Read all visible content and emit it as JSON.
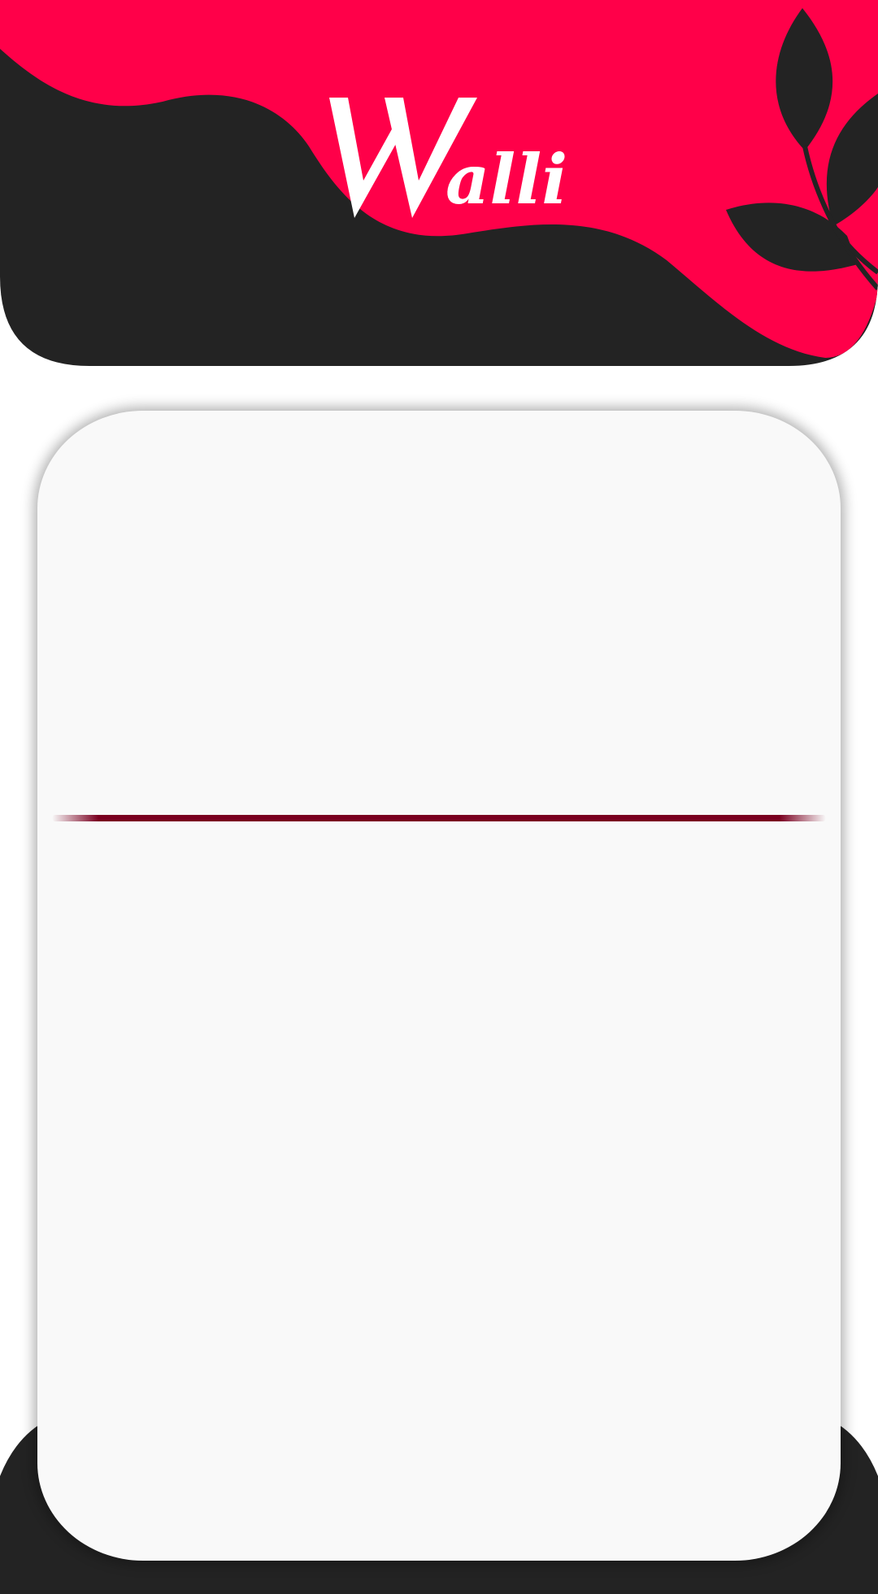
{
  "app": {
    "logo_text": "Walli"
  },
  "colors": {
    "brand_red": "#ff0049",
    "dark": "#232323",
    "card_bg": "#f9f9f9",
    "divider": "#7a0020",
    "logo_text": "#ffffff"
  },
  "icons": {
    "header_decoration": "leaf-icon"
  }
}
